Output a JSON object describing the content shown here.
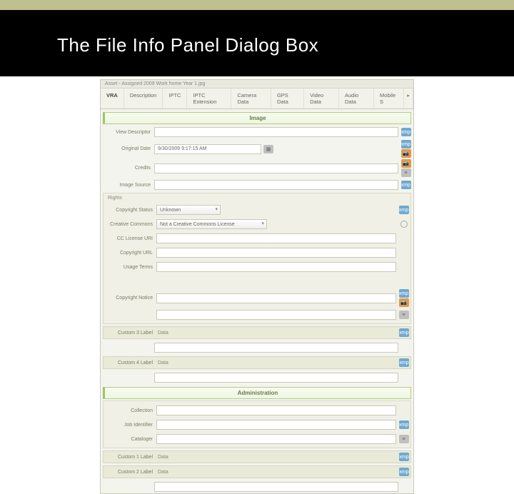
{
  "slide": {
    "title": "The File Info Panel Dialog Box"
  },
  "panel": {
    "filepath": "Asset - Assigned 2009 Work home Year 1.jpg",
    "tabs": [
      "VRA",
      "Description",
      "IPTC",
      "IPTC Extension",
      "Camera Data",
      "GPS Data",
      "Video Data",
      "Audio Data",
      "Mobile S"
    ],
    "more_marker": "▸"
  },
  "image_section": {
    "title": "Image",
    "view_desc_label": "View Descriptor",
    "original_date_label": "Original Date",
    "original_date_value": "9/30/2009 9:17:15 AM",
    "credits_label": "Credits",
    "image_source_label": "Image Source",
    "rights_label": "Rights",
    "copyright_status_label": "Copyright Status",
    "copyright_status_value": "Unknown",
    "creative_commons_label": "Creative Commons",
    "creative_commons_value": "Not a Creative Commons License",
    "cc_license_uri_label": "CC License URI",
    "copyright_url_label": "Copyright URL",
    "usage_terms_label": "Usage Terms",
    "copyright_notice_label": "Copyright Notice",
    "custom3_label": "Custom 3 Label",
    "custom4_label": "Custom 4 Label",
    "custom_data": "Data"
  },
  "admin_section": {
    "title": "Administration",
    "collection_label": "Collection",
    "job_identifier_label": "Job Identifier",
    "cataloger_label": "Cataloger",
    "custom1_label": "Custom 1 Label",
    "custom2_label": "Custom 2 Label",
    "custom_data": "Data"
  },
  "icons": {
    "xmp": "xmp",
    "camera": "📷",
    "db": "≡"
  }
}
